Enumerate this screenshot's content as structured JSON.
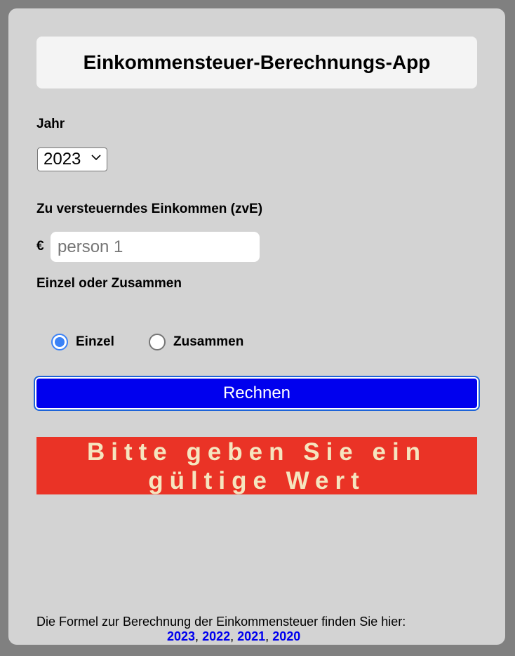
{
  "app": {
    "title": "Einkommensteuer-Berechnungs-App"
  },
  "year": {
    "label": "Jahr",
    "selected": "2023"
  },
  "income": {
    "label": "Zu versteuerndes Einkommen (zvE)",
    "currency": "€",
    "placeholder": "person 1",
    "value": ""
  },
  "filing": {
    "label": "Einzel oder Zusammen",
    "options": [
      {
        "label": "Einzel",
        "checked": true
      },
      {
        "label": "Zusammen",
        "checked": false
      }
    ]
  },
  "calculate_button": "Rechnen",
  "error_message": "Bitte geben Sie ein gültige Wert",
  "footer": {
    "text": "Die Formel zur Berechnung der Einkommensteuer finden Sie hier:",
    "links": [
      "2023",
      "2022",
      "2021",
      "2020"
    ],
    "separator": ", "
  },
  "colors": {
    "background": "#808080",
    "card": "#d3d3d3",
    "button": "#0000ee",
    "error": "#ea3326",
    "error_text": "#f5e5bf",
    "link": "#0000ee",
    "radio_accent": "#3b82f6"
  }
}
